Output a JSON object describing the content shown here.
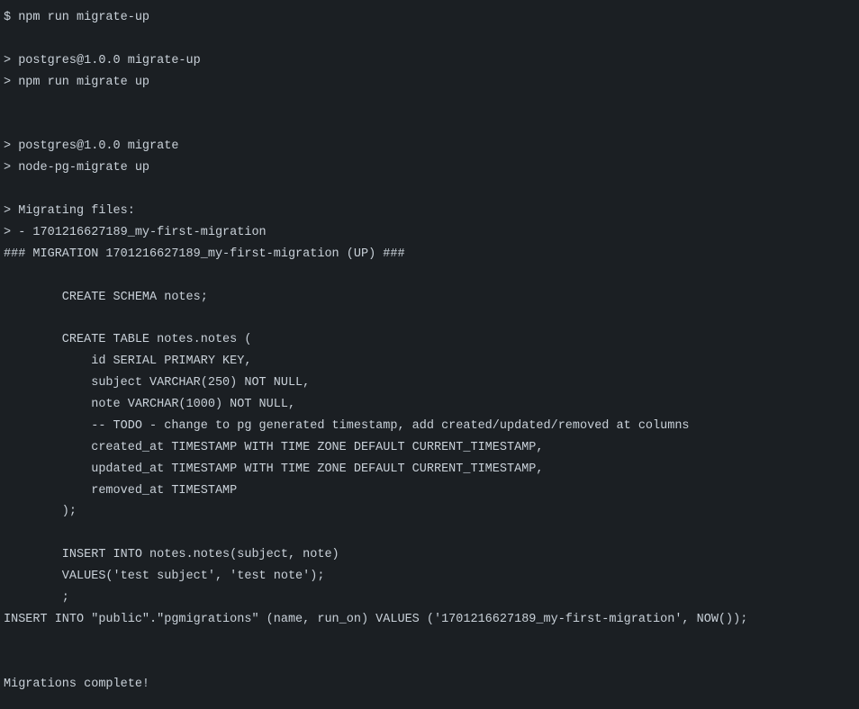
{
  "terminal": {
    "lines": [
      "$ npm run migrate-up",
      "",
      "> postgres@1.0.0 migrate-up",
      "> npm run migrate up",
      "",
      "",
      "> postgres@1.0.0 migrate",
      "> node-pg-migrate up",
      "",
      "> Migrating files:",
      "> - 1701216627189_my-first-migration",
      "### MIGRATION 1701216627189_my-first-migration (UP) ###",
      "",
      "        CREATE SCHEMA notes;",
      "",
      "        CREATE TABLE notes.notes (",
      "            id SERIAL PRIMARY KEY,",
      "            subject VARCHAR(250) NOT NULL,",
      "            note VARCHAR(1000) NOT NULL,",
      "            -- TODO - change to pg generated timestamp, add created/updated/removed at columns",
      "            created_at TIMESTAMP WITH TIME ZONE DEFAULT CURRENT_TIMESTAMP,",
      "            updated_at TIMESTAMP WITH TIME ZONE DEFAULT CURRENT_TIMESTAMP,",
      "            removed_at TIMESTAMP",
      "        );",
      "",
      "        INSERT INTO notes.notes(subject, note)",
      "        VALUES('test subject', 'test note');",
      "        ;",
      "INSERT INTO \"public\".\"pgmigrations\" (name, run_on) VALUES ('1701216627189_my-first-migration', NOW());",
      "",
      "",
      "Migrations complete!"
    ]
  }
}
